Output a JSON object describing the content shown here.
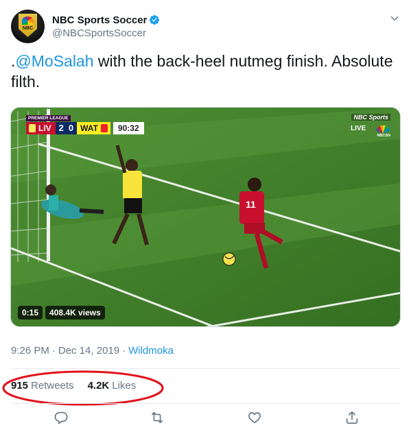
{
  "account": {
    "display_name": "NBC Sports Soccer",
    "handle": "@NBCSportsSoccer",
    "avatar_text": "NBC",
    "verified_icon": "verified-badge-icon",
    "menu_icon": "chevron-down-icon"
  },
  "tweet": {
    "prefix": ".",
    "mention": "@MoSalah",
    "text_rest": " with the back-heel nutmeg finish. Absolute filth."
  },
  "video": {
    "scorebug": {
      "league": "PREMIER LEAGUE",
      "home": "LIV",
      "home_score": "2",
      "away_score": "0",
      "away": "WAT",
      "clock": "90:32"
    },
    "broadcaster": {
      "top": "NBC Sports",
      "live": "LIVE",
      "network": "NBCSN"
    },
    "duration": "0:15",
    "views": "408.4K views",
    "player_number": "11"
  },
  "meta": {
    "time": "9:26 PM",
    "separator": "·",
    "date": "Dec 14, 2019",
    "source": "Wildmoka"
  },
  "stats": {
    "retweets_count": "915",
    "retweets_label": "Retweets",
    "likes_count": "4.2K",
    "likes_label": "Likes"
  },
  "actions": {
    "reply": "reply-icon",
    "retweet": "retweet-icon",
    "like": "heart-icon",
    "share": "share-icon"
  },
  "colors": {
    "accent": "#1b95e0",
    "annotation": "#e0121c",
    "muted": "#657786"
  }
}
